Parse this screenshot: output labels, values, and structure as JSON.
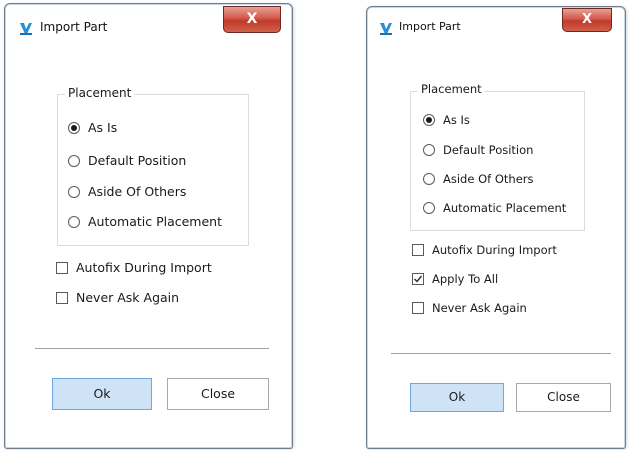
{
  "dialogs": [
    {
      "title": "Import Part",
      "close_glyph": "X",
      "placement": {
        "legend": "Placement",
        "options": [
          {
            "label": "As Is",
            "selected": true
          },
          {
            "label": "Default Position",
            "selected": false
          },
          {
            "label": "Aside Of Others",
            "selected": false
          },
          {
            "label": "Automatic Placement",
            "selected": false
          }
        ]
      },
      "checkboxes": [
        {
          "label": "Autofix During Import",
          "checked": false
        },
        {
          "label": "Never Ask Again",
          "checked": false
        }
      ],
      "buttons": {
        "ok": "Ok",
        "close": "Close"
      }
    },
    {
      "title": "Import Part",
      "close_glyph": "X",
      "placement": {
        "legend": "Placement",
        "options": [
          {
            "label": "As Is",
            "selected": true
          },
          {
            "label": "Default Position",
            "selected": false
          },
          {
            "label": "Aside Of Others",
            "selected": false
          },
          {
            "label": "Automatic Placement",
            "selected": false
          }
        ]
      },
      "checkboxes": [
        {
          "label": "Autofix During Import",
          "checked": false
        },
        {
          "label": "Apply To All",
          "checked": true
        },
        {
          "label": "Never Ask Again",
          "checked": false
        }
      ],
      "buttons": {
        "ok": "Ok",
        "close": "Close"
      }
    }
  ],
  "colors": {
    "accent_button": "#cfe3f7",
    "close_button": "#c9463a",
    "app_icon": "#2a8fd6"
  },
  "icons": {
    "app": "import-part-app-icon",
    "close": "close-x-icon"
  }
}
